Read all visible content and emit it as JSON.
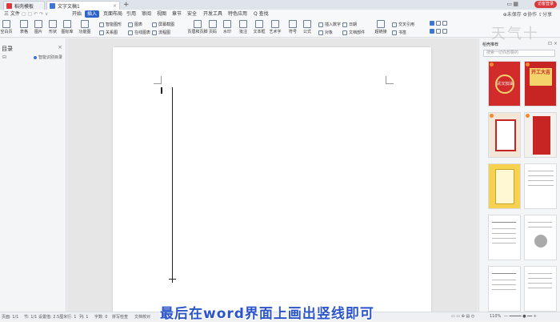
{
  "titlebar": {
    "tabs": [
      {
        "label": "稻壳模板",
        "icon": "daoke-icon",
        "active": false
      },
      {
        "label": "文字文稿1",
        "icon": "doc-icon",
        "active": true
      }
    ],
    "new_tab": "+",
    "login": "访客登录"
  },
  "menubar": {
    "file_menu": "三 文件",
    "items": [
      "开始",
      "插入",
      "页面布局",
      "引用",
      "审阅",
      "视图",
      "章节",
      "安全",
      "开发工具",
      "特色应用"
    ],
    "search": "Q 查找",
    "active": "插入",
    "right_tools": "⊕未保存 ⚙协作 ⇪分享"
  },
  "toolbar": {
    "row1": [
      "智能图形",
      "图表",
      "形状",
      "屏幕截图",
      "插入数字",
      "日期",
      "对象",
      "文档部件",
      "交叉引用"
    ],
    "row2": [
      "关系图",
      "在线图表",
      "流程图",
      "思维导图",
      "文本框",
      "艺术字",
      "符号",
      "公式",
      "附件",
      "超链接",
      "书签"
    ],
    "big": [
      "空白页",
      "表格",
      "图片",
      "形状",
      "图标库",
      "功能图",
      "页眉和页脚",
      "页码",
      "水印",
      "批注"
    ]
  },
  "left_panel": {
    "title": "目录",
    "close": "×",
    "collapse": "⊟",
    "smart_label": "智能识别目录"
  },
  "right_panel": {
    "title": "稻壳推荐",
    "search_placeholder": "搜索一切你想要的",
    "watermark": "天气十",
    "thumbnails": [
      {
        "kind": "red",
        "text": "武汉加油"
      },
      {
        "kind": "red2",
        "text": "开工大吉"
      },
      {
        "kind": "paper",
        "text": ""
      },
      {
        "kind": "red",
        "text": ""
      },
      {
        "kind": "phone",
        "text": ""
      },
      {
        "kind": "text",
        "text": ""
      },
      {
        "kind": "text",
        "text": ""
      },
      {
        "kind": "text",
        "text": ""
      },
      {
        "kind": "text",
        "text": ""
      },
      {
        "kind": "text",
        "text": ""
      }
    ]
  },
  "status": {
    "page": "页面: 1/1",
    "section": "节: 1/1",
    "position": "设置值: 2.5厘米",
    "row": "行: 1",
    "col": "列: 1",
    "words": "字数: 0",
    "spell": "拼写检查",
    "proof": "文档校对",
    "zoom": "110%"
  },
  "subtitle": "最后在word界面上画出竖线即可"
}
